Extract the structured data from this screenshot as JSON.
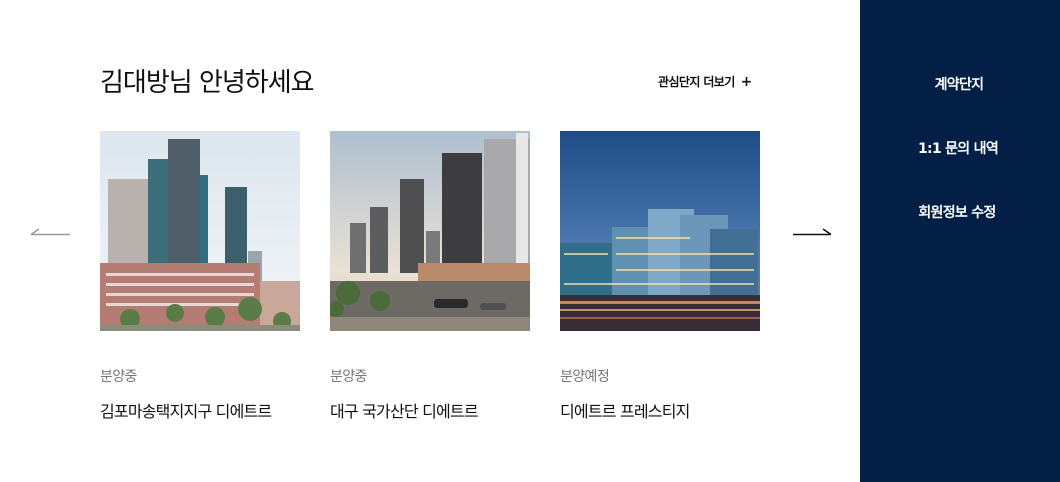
{
  "header": {
    "greeting": "김대방님 안녕하세요",
    "more_label": "관심단지 더보기",
    "more_icon": "plus-icon"
  },
  "carousel": {
    "prev_icon": "arrow-left-icon",
    "next_icon": "arrow-right-icon",
    "cards": [
      {
        "status": "분양중",
        "name": "김포마송택지지구 디에트르"
      },
      {
        "status": "분양중",
        "name": "대구 국가산단 디에트르"
      },
      {
        "status": "분양예정",
        "name": "디에트르 프레스티지"
      }
    ]
  },
  "sidebar": {
    "items": [
      {
        "label": "계약단지"
      },
      {
        "label": "1:1 문의 내역"
      },
      {
        "label": "회원정보 수정"
      }
    ]
  },
  "colors": {
    "sidebar_bg": "#041f45",
    "text_primary": "#111111",
    "text_muted": "#777777",
    "arrow_prev": "#9a9a9a",
    "arrow_next": "#111111"
  }
}
